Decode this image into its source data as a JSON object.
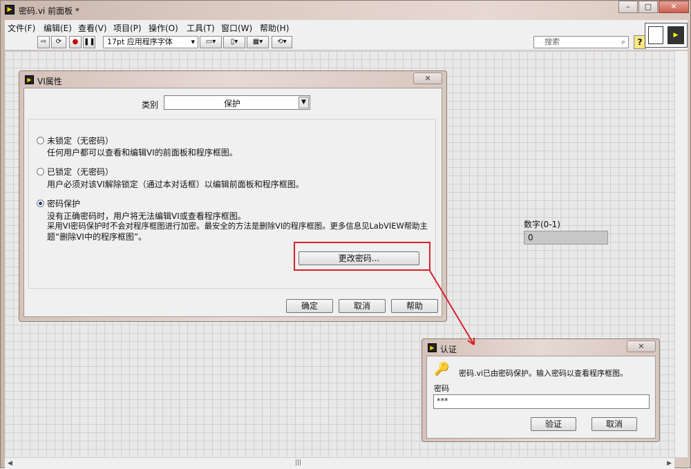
{
  "window": {
    "title": "密码.vi 前面板 *",
    "caption": [
      "–",
      "□",
      "✕"
    ]
  },
  "menu": [
    "文件(F)",
    "编辑(E)",
    "查看(V)",
    "项目(P)",
    "操作(O)",
    "工具(T)",
    "窗口(W)",
    "帮助(H)"
  ],
  "toolbar": {
    "font": "17pt 应用程序字体",
    "search_placeholder": "搜索",
    "help": "?"
  },
  "front_panel": {
    "numeric_label": "数字(0-1)",
    "numeric_value": "0"
  },
  "vi_properties": {
    "title": "VI属性",
    "category_label": "类别",
    "category_value": "保护",
    "options": [
      {
        "label": "未锁定（无密码）",
        "desc": "任何用户都可以查看和编辑VI的前面板和程序框图。",
        "selected": false
      },
      {
        "label": "已锁定（无密码）",
        "desc": "用户必须对该VI解除锁定（通过本对话框）以编辑前面板和程序框图。",
        "selected": false
      },
      {
        "label": "密码保护",
        "desc_lines": [
          "没有正确密码时，用户将无法编辑VI或查看程序框图。",
          "采用VI密码保护时不会对程序框图进行加密。最安全的方法是删除VI的程序框图。更多信息见LabVIEW帮助主",
          "题“删除VI中的程序框图”。"
        ],
        "selected": true
      }
    ],
    "change_password": "更改密码...",
    "ok": "确定",
    "cancel": "取消",
    "help": "帮助"
  },
  "auth": {
    "title": "认证",
    "message": "密码.vi已由密码保护。输入密码以查看程序框图。",
    "password_label": "密码",
    "password_value": "***",
    "ok": "验证",
    "cancel": "取消"
  },
  "colors": {
    "highlight": "#d81f26"
  }
}
